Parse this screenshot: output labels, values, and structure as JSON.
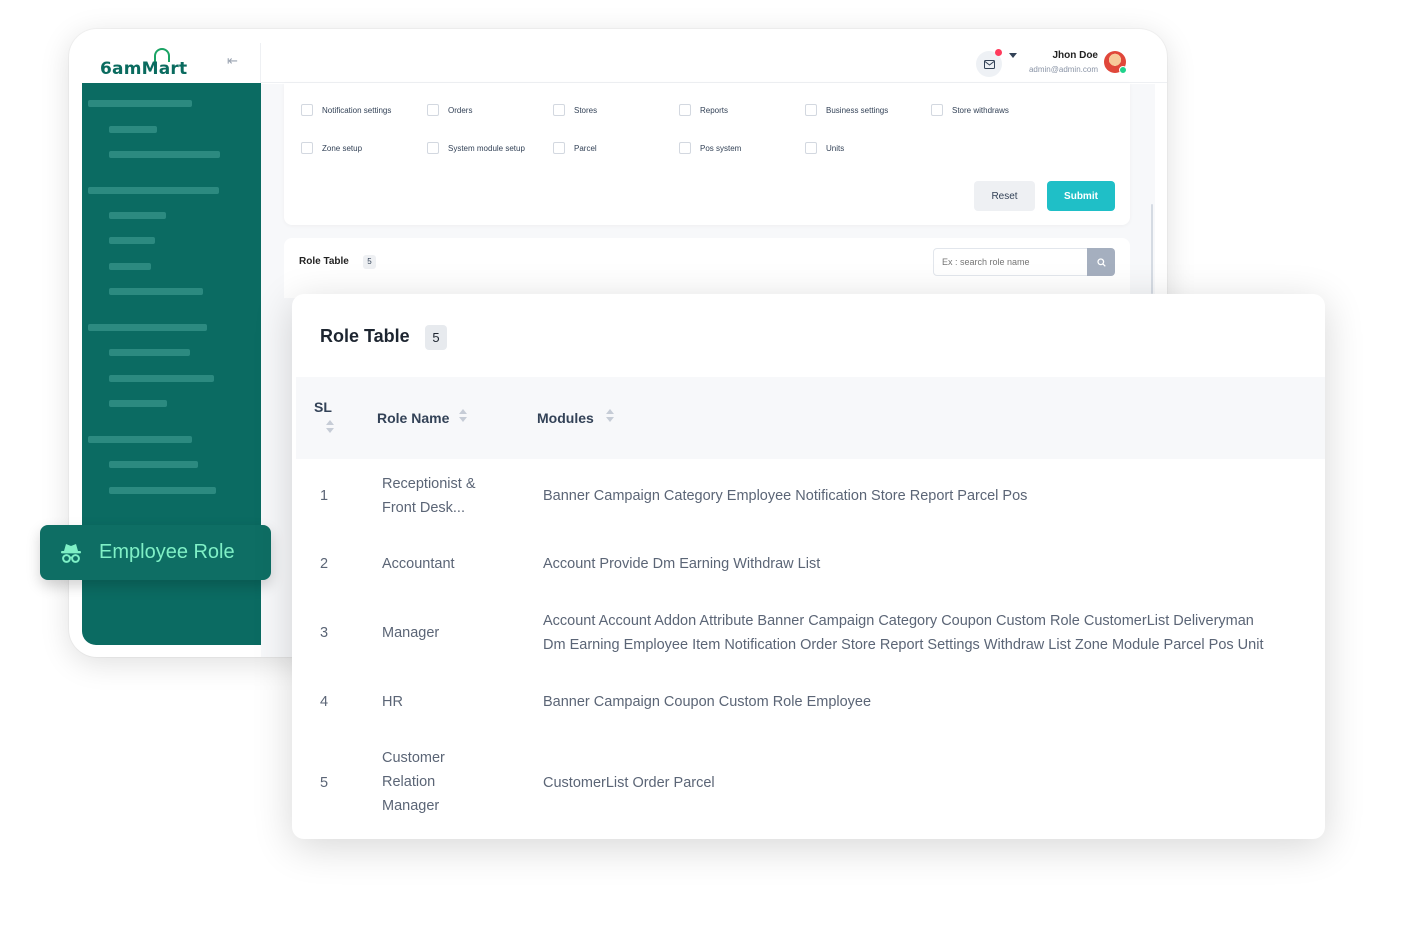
{
  "app": {
    "logo_text": "6amMart",
    "brand_color": "#0b6b62",
    "accent_color": "#1fbfc7"
  },
  "header": {
    "user_name": "Jhon Doe",
    "user_email": "admin@admin.com",
    "message_icon": "mail-icon",
    "collapse_icon": "collapse-icon"
  },
  "permissions": {
    "items": [
      {
        "label": "Notification settings",
        "checked": false
      },
      {
        "label": "Orders",
        "checked": false
      },
      {
        "label": "Stores",
        "checked": false
      },
      {
        "label": "Reports",
        "checked": false
      },
      {
        "label": "Business settings",
        "checked": false
      },
      {
        "label": "Store withdraws",
        "checked": false
      },
      {
        "label": "Zone setup",
        "checked": false
      },
      {
        "label": "System module setup",
        "checked": false
      },
      {
        "label": "Parcel",
        "checked": false
      },
      {
        "label": "Pos system",
        "checked": false
      },
      {
        "label": "Units",
        "checked": false
      }
    ],
    "reset_label": "Reset",
    "submit_label": "Submit"
  },
  "small_role_table": {
    "title": "Role Table",
    "count": "5",
    "search_placeholder": "Ex : search role name"
  },
  "employee_role_chip": {
    "label": "Employee Role",
    "icon": "spy-icon"
  },
  "role_table": {
    "title": "Role Table",
    "count": "5",
    "columns": {
      "sl": "SL",
      "role_name": "Role Name",
      "modules": "Modules"
    },
    "rows": [
      {
        "sl": "1",
        "role": "Receptionist & Front Desk...",
        "modules": "Banner Campaign Category Employee Notification Store Report Parcel Pos"
      },
      {
        "sl": "2",
        "role": "Accountant",
        "modules": "Account Provide Dm Earning Withdraw List"
      },
      {
        "sl": "3",
        "role": "Manager",
        "modules": "Account Account Addon Attribute Banner Campaign Category Coupon Custom Role CustomerList Deliveryman\nDm Earning Employee Item Notification Order Store Report Settings Withdraw List Zone Module Parcel Pos Unit"
      },
      {
        "sl": "4",
        "role": "HR",
        "modules": "Banner Campaign Coupon Custom Role Employee"
      },
      {
        "sl": "5",
        "role": "Customer Relation Manager",
        "modules": "CustomerList Order Parcel"
      }
    ]
  }
}
